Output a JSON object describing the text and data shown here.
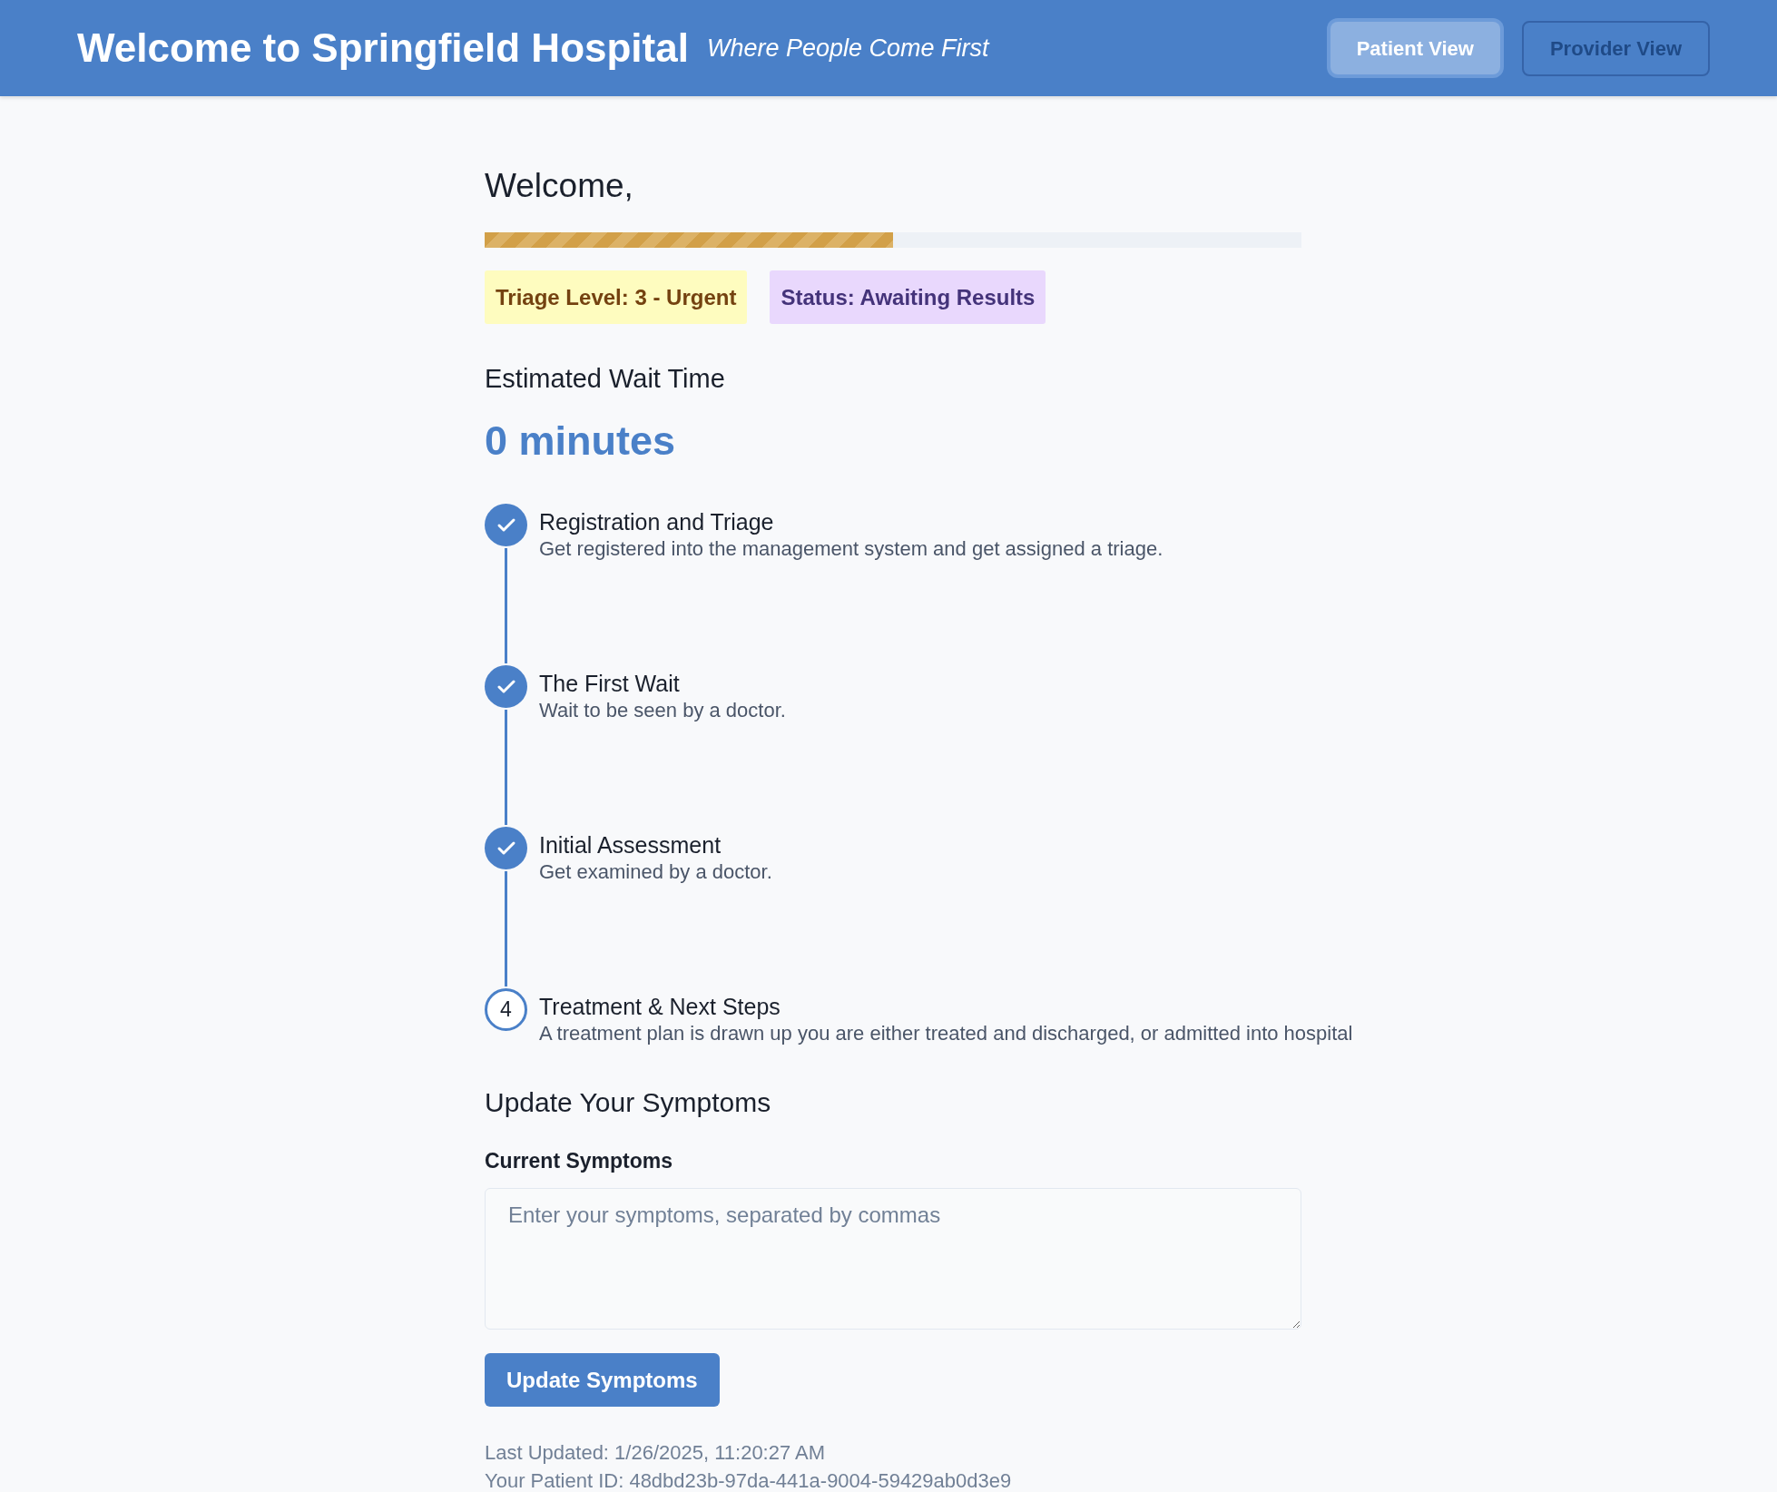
{
  "header": {
    "title": "Welcome to Springfield Hospital",
    "tagline": "Where People Come First",
    "views": [
      {
        "label": "Patient View",
        "selected": true
      },
      {
        "label": "Provider View",
        "selected": false
      }
    ]
  },
  "greeting": "Welcome,",
  "progress": {
    "level": 0.5
  },
  "badges": [
    {
      "kind": "triage",
      "text": "Triage Level: 3 - Urgent"
    },
    {
      "kind": "status",
      "text": "Status: Awaiting Results"
    }
  ],
  "wait": {
    "heading": "Estimated Wait Time",
    "value": "0 minutes"
  },
  "steps": [
    {
      "title": "Registration and Triage",
      "description": "Get registered into the management system and get assigned a triage.",
      "done": true
    },
    {
      "title": "The First Wait",
      "description": "Wait to be seen by a doctor.",
      "done": true
    },
    {
      "title": "Initial Assessment",
      "description": "Get examined by a doctor.",
      "done": true
    },
    {
      "title": "Treatment & Next Steps",
      "description": "A treatment plan is drawn up you are either treated and discharged, or admitted into hospital",
      "done": false,
      "number": "4"
    }
  ],
  "symptoms": {
    "heading": "Update Your Symptoms",
    "label": "Current Symptoms",
    "placeholder": "Enter your symptoms, separated by commas",
    "button": "Update Symptoms"
  },
  "footer": {
    "last_updated": "Last Updated: 1/26/2025, 11:20:27 AM",
    "patient_id": "Your Patient ID: 48dbd23b-97da-441a-9004-59429ab0d3e9"
  }
}
